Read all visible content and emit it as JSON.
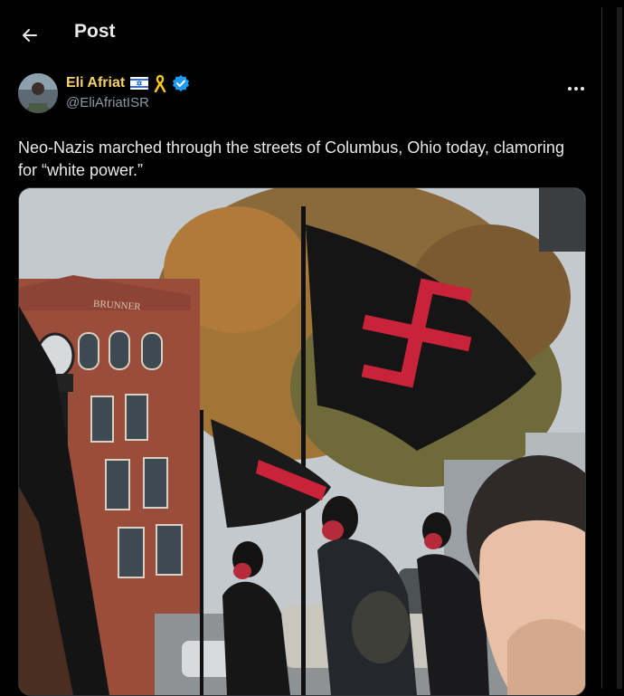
{
  "header": {
    "title": "Post"
  },
  "post": {
    "author": {
      "display_name": "Eli Afriat",
      "handle": "@EliAfriatISR",
      "flag_icon": "israel-flag-icon",
      "ribbon_icon": "yellow-ribbon-icon",
      "verified_icon": "verified-badge-icon"
    },
    "text": "Neo-Nazis marched through the streets of Columbus, Ohio today, clamoring for “white power.”",
    "media": {
      "building_sign": "BRUNNER"
    }
  },
  "colors": {
    "background": "#000000",
    "text": "#e7e9ea",
    "secondary_text": "#8b98a5",
    "display_name": "#f5d36a",
    "verified": "#1d9bf0",
    "border": "#2f3336"
  }
}
